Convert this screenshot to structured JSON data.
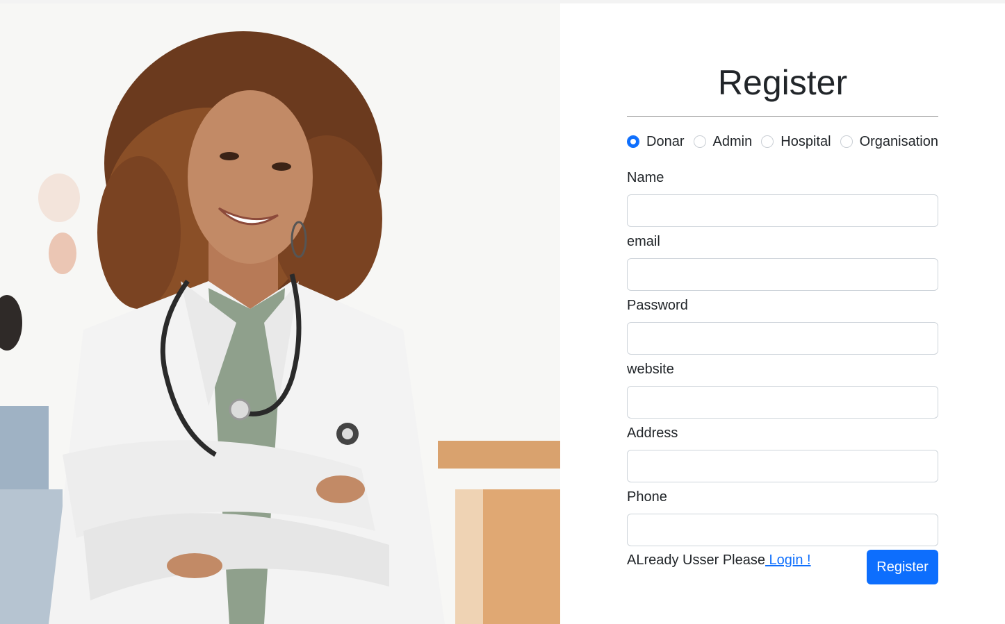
{
  "page": {
    "title": "Register"
  },
  "roles": [
    {
      "label": "Donar",
      "checked": true
    },
    {
      "label": "Admin",
      "checked": false
    },
    {
      "label": "Hospital",
      "checked": false
    },
    {
      "label": "Organisation",
      "checked": false
    }
  ],
  "fields": {
    "name": {
      "label": "Name",
      "value": "",
      "placeholder": ""
    },
    "email": {
      "label": "email",
      "value": "",
      "placeholder": ""
    },
    "password": {
      "label": "Password",
      "value": "",
      "placeholder": ""
    },
    "website": {
      "label": "website",
      "value": "",
      "placeholder": ""
    },
    "address": {
      "label": "Address",
      "value": "",
      "placeholder": ""
    },
    "phone": {
      "label": "Phone",
      "value": "",
      "placeholder": ""
    }
  },
  "footer": {
    "prompt": "ALready Usser Please",
    "login_link": " Login !"
  },
  "actions": {
    "register_label": "Register"
  },
  "colors": {
    "primary": "#0d6efd",
    "text": "#212529",
    "input_border": "#ced4da"
  },
  "image": {
    "alt_subject": "doctor-photo"
  }
}
